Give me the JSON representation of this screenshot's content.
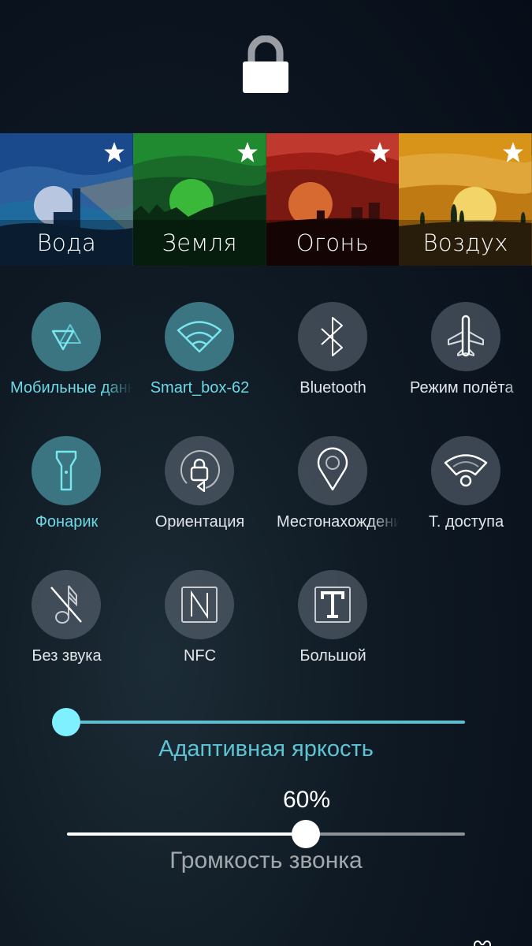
{
  "lock": {
    "icon": "lock-icon"
  },
  "ambiences": [
    {
      "label": "Вода",
      "favorite": true,
      "color": "#1f4f8a",
      "scene": "lighthouse"
    },
    {
      "label": "Земля",
      "favorite": true,
      "color": "#1f7a2a",
      "scene": "forest"
    },
    {
      "label": "Огонь",
      "favorite": true,
      "color": "#b02a22",
      "scene": "castle"
    },
    {
      "label": "Воздух",
      "favorite": true,
      "color": "#d8961a",
      "scene": "cypress"
    }
  ],
  "toggles": [
    {
      "label": "Мобильные данные",
      "icon": "mobile-data-icon",
      "active": true
    },
    {
      "label": "Smart_box-62",
      "icon": "wifi-icon",
      "active": true
    },
    {
      "label": "Bluetooth",
      "icon": "bluetooth-icon",
      "active": false
    },
    {
      "label": "Режим полёта",
      "icon": "airplane-icon",
      "active": false
    },
    {
      "label": "Фонарик",
      "icon": "flashlight-icon",
      "active": true
    },
    {
      "label": "Ориентация",
      "icon": "orientation-lock-icon",
      "active": false
    },
    {
      "label": "Местонахождение",
      "icon": "location-icon",
      "active": false
    },
    {
      "label": "Т. доступа",
      "icon": "hotspot-icon",
      "active": false
    },
    {
      "label": "Без звука",
      "icon": "silent-icon",
      "active": false
    },
    {
      "label": "NFC",
      "icon": "nfc-icon",
      "active": false
    },
    {
      "label": "Большой",
      "icon": "large-text-icon",
      "active": false
    }
  ],
  "brightness": {
    "label": "Адаптивная яркость",
    "value_fraction": 0.0
  },
  "volume": {
    "label": "Громкость звонка",
    "value_text": "60%",
    "value_percent": 60
  },
  "colors": {
    "accent": "#6fd8e6",
    "active_circle": "#3b7582"
  }
}
